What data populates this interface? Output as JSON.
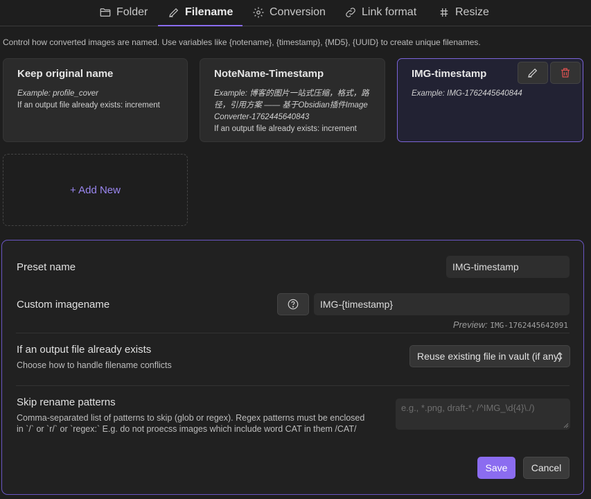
{
  "tabs": [
    {
      "label": "Folder",
      "icon": "folder-icon"
    },
    {
      "label": "Filename",
      "icon": "pencil-icon",
      "active": true
    },
    {
      "label": "Conversion",
      "icon": "gear-icon"
    },
    {
      "label": "Link format",
      "icon": "link-icon"
    },
    {
      "label": "Resize",
      "icon": "hash-icon"
    }
  ],
  "description": "Control how converted images are named. Use variables like {notename}, {timestamp}, {MD5}, {UUID} to create unique filenames.",
  "presets": [
    {
      "title": "Keep original name",
      "example": "Example: profile_cover",
      "conflict": "If an output file already exists: increment"
    },
    {
      "title": "NoteName-Timestamp",
      "example": "Example: 博客的图片一站式压缩，格式，路径，引用方案 —— 基于Obsidian插件Image Converter-1762445640843",
      "conflict": "If an output file already exists: increment"
    },
    {
      "title": "IMG-timestamp",
      "example": "Example: IMG-1762445640844",
      "selected": true
    }
  ],
  "add_new_label": "+ Add New",
  "editor": {
    "preset_name_label": "Preset name",
    "preset_name_value": "IMG-timestamp",
    "custom_name_label": "Custom imagename",
    "custom_name_value": "IMG-{timestamp}",
    "preview_label": "Preview:",
    "preview_value": "IMG-1762445642091",
    "conflict_label": "If an output file already exists",
    "conflict_desc": "Choose how to handle filename conflicts",
    "conflict_selected": "Reuse existing file in vault (if any)",
    "skip_label": "Skip rename patterns",
    "skip_desc": "Comma-separated list of patterns to skip (glob or regex). Regex patterns must be enclosed in `/` or `r/` or `regex:` E.g. do not proecss images which include word CAT in them /CAT/",
    "skip_placeholder": "e.g., *.png, draft-*, /^IMG_\\d{4}\\./)",
    "save_label": "Save",
    "cancel_label": "Cancel"
  },
  "colors": {
    "accent": "#8b6cf0",
    "background": "#1e1e1e",
    "delete": "#e05252"
  }
}
